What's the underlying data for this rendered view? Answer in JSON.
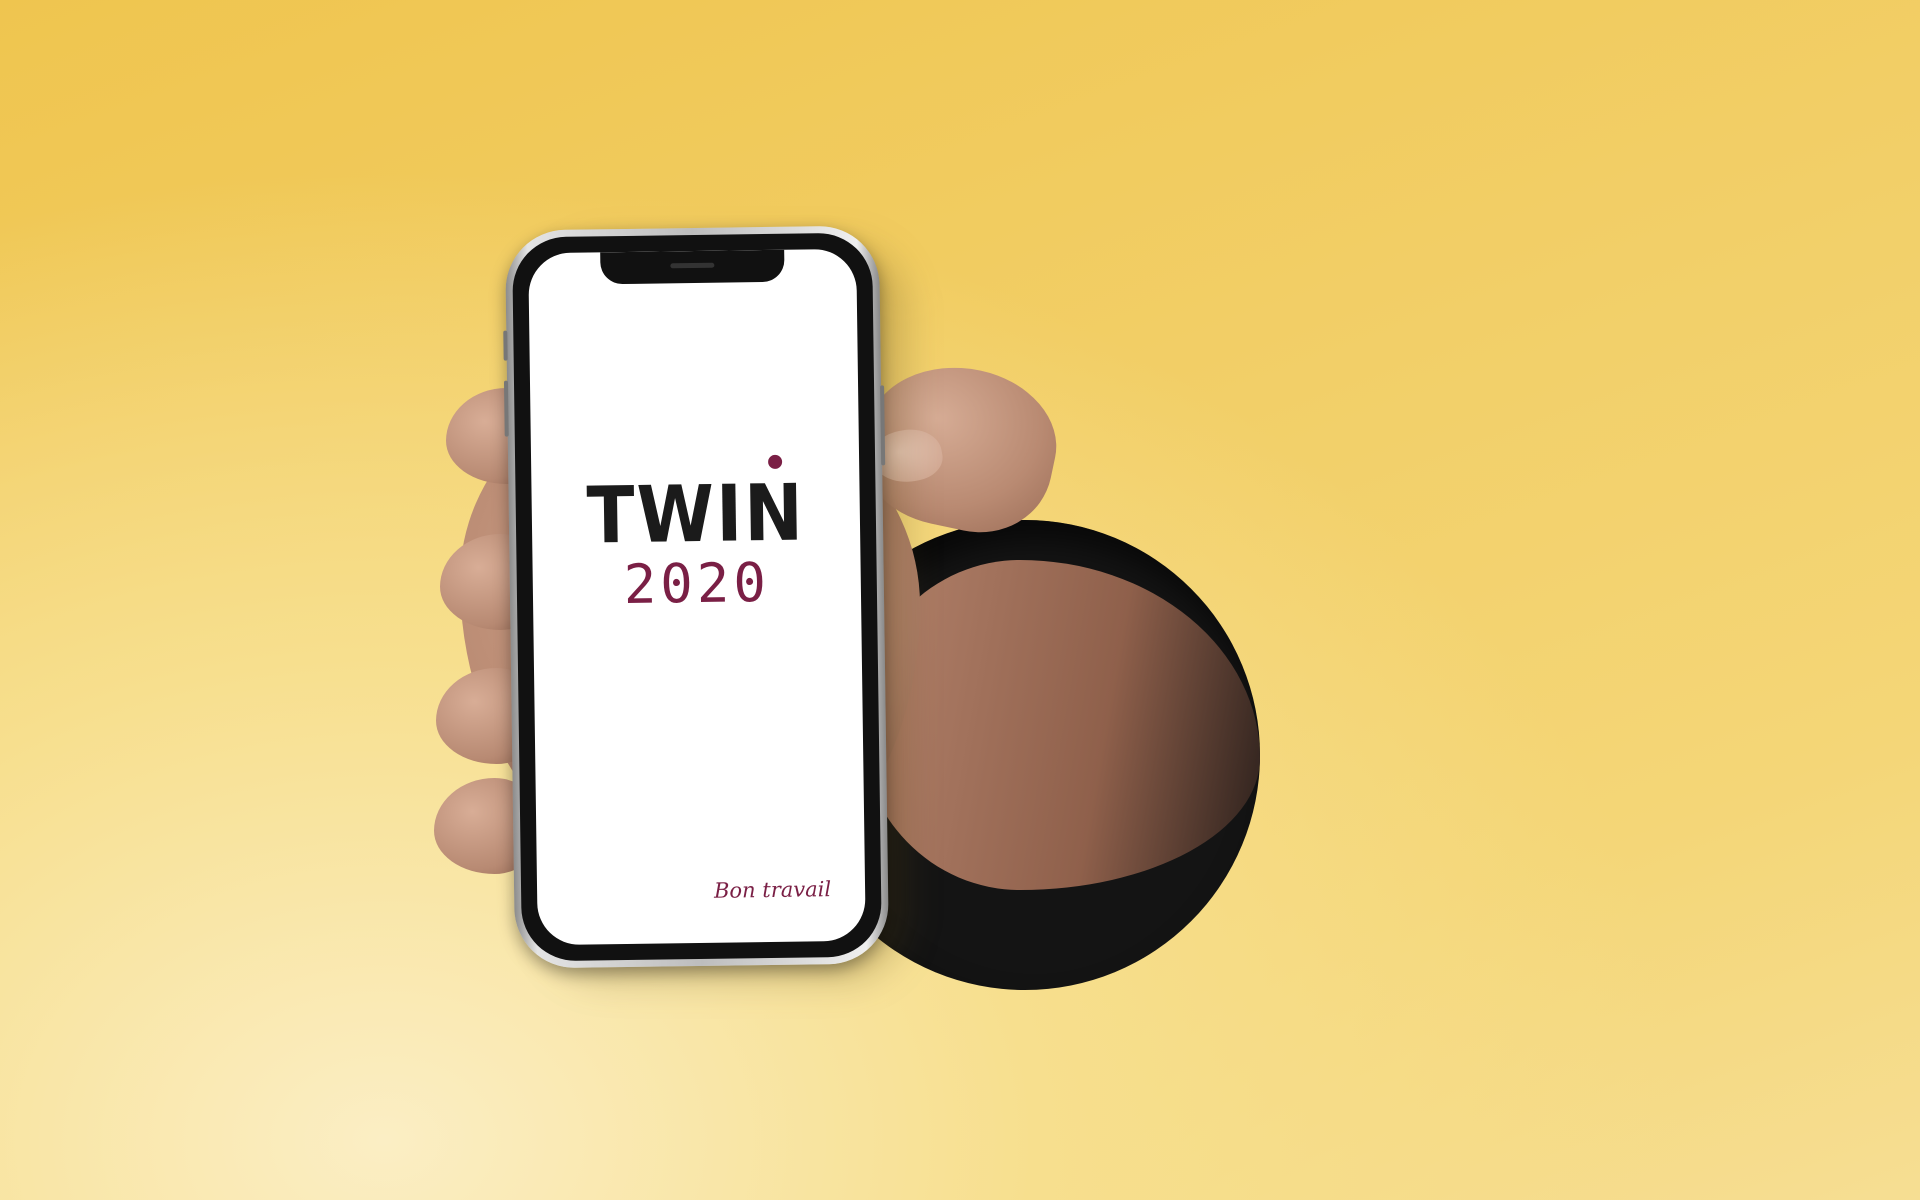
{
  "screen": {
    "logo_word": "TWIN",
    "logo_year": "2020",
    "tagline": "Bon travail"
  },
  "colors": {
    "brand_dark": "#1b1b1b",
    "brand_accent": "#7a1f45",
    "background": "#f2cf68"
  }
}
